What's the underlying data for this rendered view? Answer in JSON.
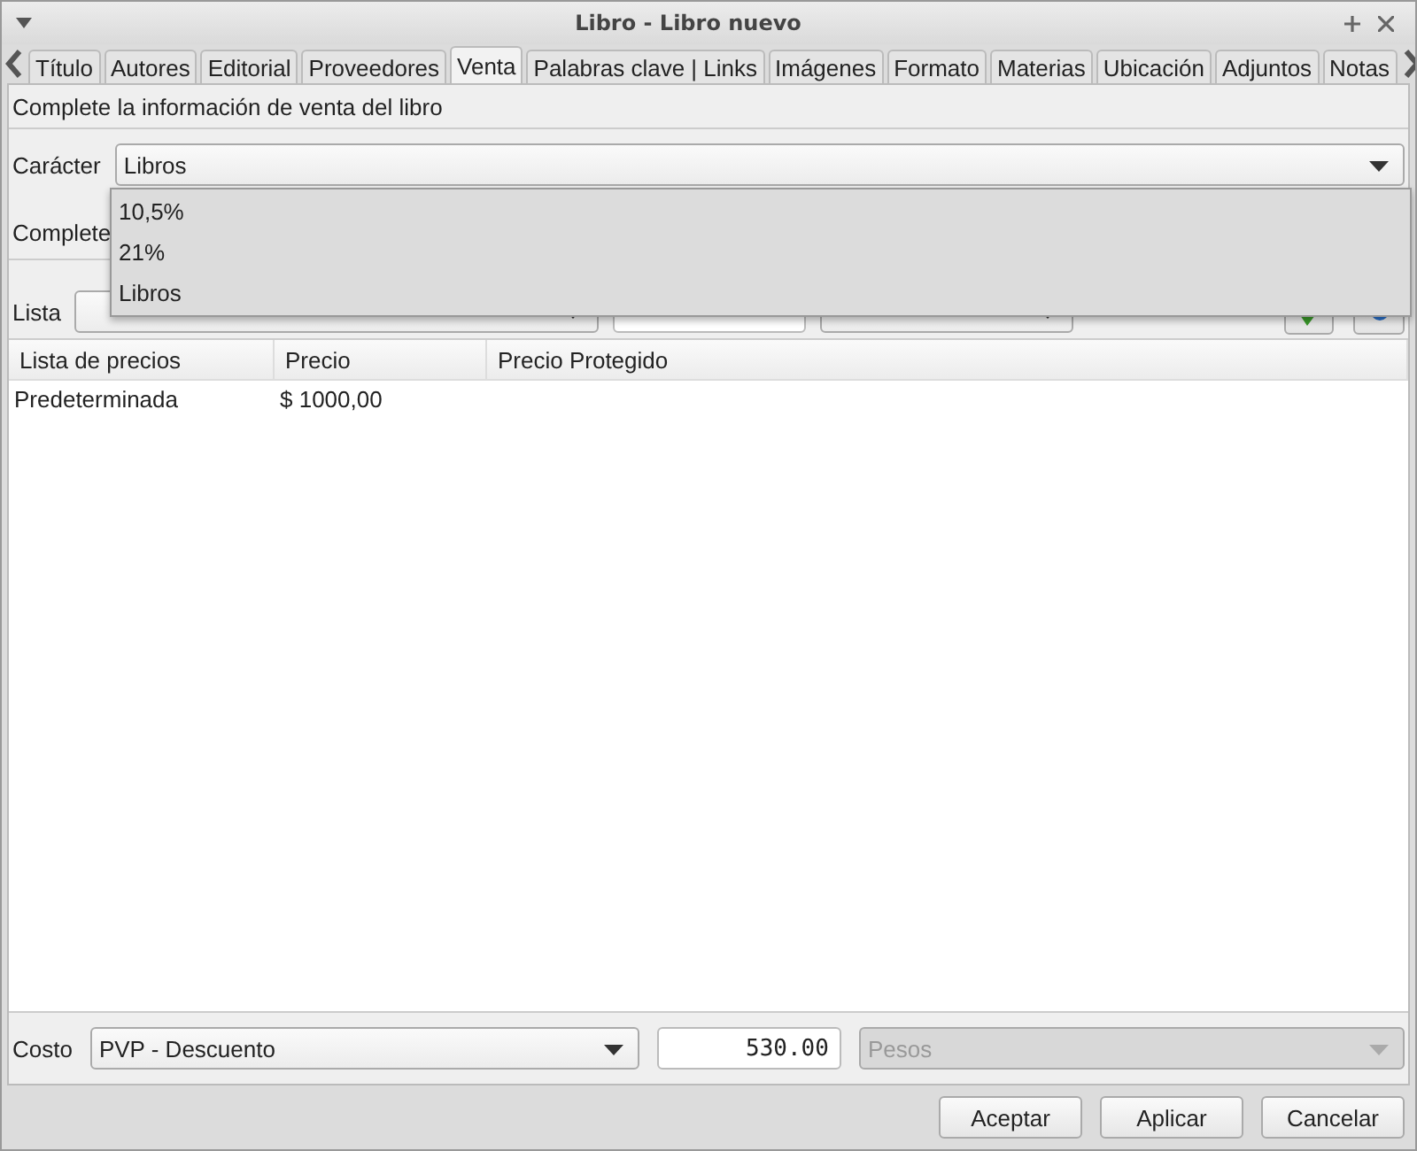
{
  "window": {
    "title": "Libro - Libro nuevo"
  },
  "tabs": [
    {
      "label": "Título",
      "selected": false
    },
    {
      "label": "Autores",
      "selected": false
    },
    {
      "label": "Editorial",
      "selected": false
    },
    {
      "label": "Proveedores",
      "selected": false
    },
    {
      "label": "Venta",
      "selected": true
    },
    {
      "label": "Palabras clave | Links",
      "selected": false
    },
    {
      "label": "Imágenes",
      "selected": false
    },
    {
      "label": "Formato",
      "selected": false
    },
    {
      "label": "Materias",
      "selected": false
    },
    {
      "label": "Ubicación",
      "selected": false
    },
    {
      "label": "Adjuntos",
      "selected": false
    },
    {
      "label": "Notas",
      "selected": false
    }
  ],
  "header": "Complete la información de venta del libro",
  "caracter": {
    "label": "Carácter",
    "value": "Libros",
    "options": [
      "10,5%",
      "21%",
      "Libros"
    ]
  },
  "complete_label": "Complete",
  "lista": {
    "label": "Lista"
  },
  "table": {
    "columns": [
      "Lista de precios",
      "Precio",
      "Precio Protegido"
    ],
    "rows": [
      [
        "Predeterminada",
        "$ 1000,00",
        ""
      ]
    ]
  },
  "costo": {
    "label": "Costo",
    "value": "PVP - Descuento",
    "amount": "530.00",
    "currency": "Pesos",
    "currency_disabled": true
  },
  "buttons": [
    "Aceptar",
    "Aplicar",
    "Cancelar"
  ]
}
